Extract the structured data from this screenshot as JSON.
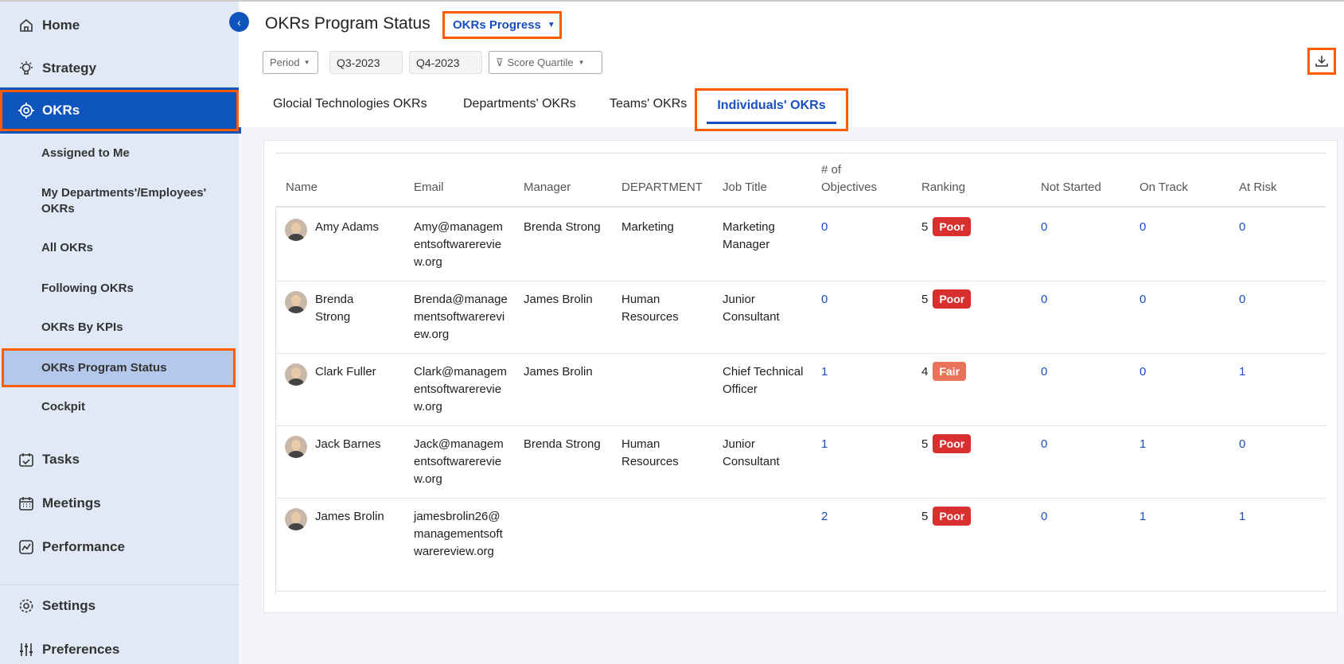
{
  "sidebar": {
    "nav": [
      {
        "label": "Home",
        "icon": "home-icon"
      },
      {
        "label": "Strategy",
        "icon": "lightbulb-icon"
      },
      {
        "label": "OKRs",
        "icon": "target-icon"
      },
      {
        "label": "Tasks",
        "icon": "calendar-check-icon"
      },
      {
        "label": "Meetings",
        "icon": "calendar-icon"
      },
      {
        "label": "Performance",
        "icon": "chart-line-icon"
      },
      {
        "label": "Settings",
        "icon": "gear-icon"
      },
      {
        "label": "Preferences",
        "icon": "sliders-icon"
      }
    ],
    "okr_sub": [
      "Assigned to Me",
      "My Departments'/Employees' OKRs",
      "All OKRs",
      "Following OKRs",
      "OKRs By KPIs",
      "OKRs Program Status",
      "Cockpit"
    ]
  },
  "header": {
    "title": "OKRs Program Status",
    "view_select": "OKRs Progress",
    "filters": {
      "period": "Period",
      "from": "Q3-2023",
      "to": "Q4-2023",
      "score_quartile": "Score Quartile"
    }
  },
  "tabs": [
    "Glocial Technologies OKRs",
    "Departments' OKRs",
    "Teams' OKRs",
    "Individuals' OKRs"
  ],
  "colors": {
    "poor": "#d9302f",
    "fair": "#e8735a",
    "accent": "#0d54bd",
    "highlight": "#ff5c00"
  },
  "table": {
    "columns": [
      "Name",
      "Email",
      "Manager",
      "DEPARTMENT",
      "Job Title",
      "# of Objectives",
      "Ranking",
      "Not Started",
      "On Track",
      "At Risk"
    ],
    "rows": [
      {
        "name": "Amy Adams",
        "email": "Amy@managementsoftwarereview.org",
        "manager": "Brenda Strong",
        "department": "Marketing",
        "job": "Marketing Manager",
        "objectives": "0",
        "rank": "5",
        "rank_label": "Poor",
        "not_started": "0",
        "on_track": "0",
        "at_risk": "0"
      },
      {
        "name": "Brenda Strong",
        "email": "Brenda@managementsoftwarereview.org",
        "manager": "James Brolin",
        "department": "Human Resources",
        "job": "Junior Consultant",
        "objectives": "0",
        "rank": "5",
        "rank_label": "Poor",
        "not_started": "0",
        "on_track": "0",
        "at_risk": "0"
      },
      {
        "name": "Clark Fuller",
        "email": "Clark@managementsoftwarereview.org",
        "manager": "James Brolin",
        "department": "",
        "job": "Chief Technical Officer",
        "objectives": "1",
        "rank": "4",
        "rank_label": "Fair",
        "not_started": "0",
        "on_track": "0",
        "at_risk": "1"
      },
      {
        "name": "Jack Barnes",
        "email": "Jack@managementsoftwarereview.org",
        "manager": "Brenda Strong",
        "department": "Human Resources",
        "job": "Junior Consultant",
        "objectives": "1",
        "rank": "5",
        "rank_label": "Poor",
        "not_started": "0",
        "on_track": "1",
        "at_risk": "0"
      },
      {
        "name": "James Brolin",
        "email": "jamesbrolin26@managementsoftwarereview.org",
        "manager": "",
        "department": "",
        "job": "",
        "objectives": "2",
        "rank": "5",
        "rank_label": "Poor",
        "not_started": "0",
        "on_track": "1",
        "at_risk": "1"
      }
    ]
  }
}
